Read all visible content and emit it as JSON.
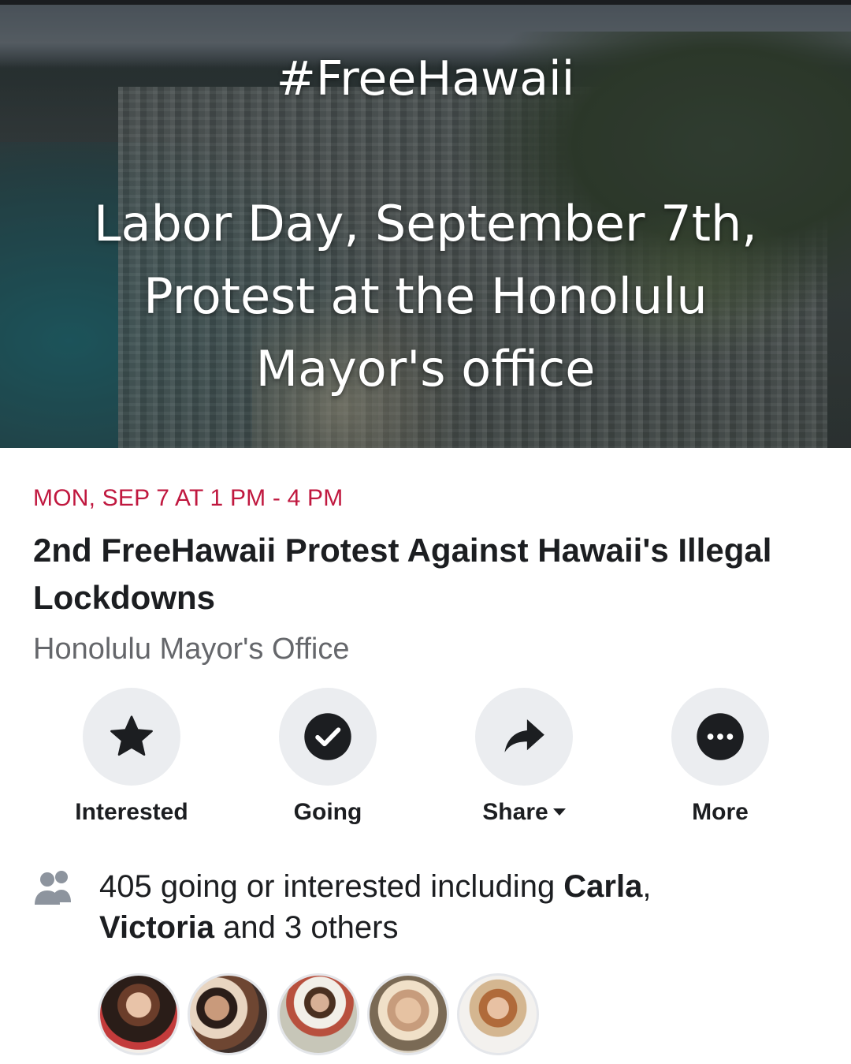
{
  "cover": {
    "hashtag": "#FreeHawaii",
    "lines": [
      "Labor Day, September 7th,",
      "Protest at the Honolulu",
      "Mayor's office"
    ]
  },
  "event": {
    "date": "MON, SEP 7 AT 1 PM - 4 PM",
    "title": "2nd FreeHawaii Protest Against Hawaii's Illegal Lockdowns",
    "location": "Honolulu Mayor's Office"
  },
  "actions": [
    {
      "label": "Interested",
      "icon": "star-icon"
    },
    {
      "label": "Going",
      "icon": "check-circle-icon"
    },
    {
      "label": "Share",
      "icon": "share-arrow-icon"
    },
    {
      "label": "More",
      "icon": "more-dots-icon"
    }
  ],
  "attendees": {
    "count_text": "405 going or interested including ",
    "name1": "Carla",
    "sep1": ",",
    "name2": "Victoria",
    "rest": " and 3 others"
  },
  "colors": {
    "date_accent": "#c0183f",
    "secondary_text": "#65676b",
    "button_circle": "#ebedf0"
  }
}
